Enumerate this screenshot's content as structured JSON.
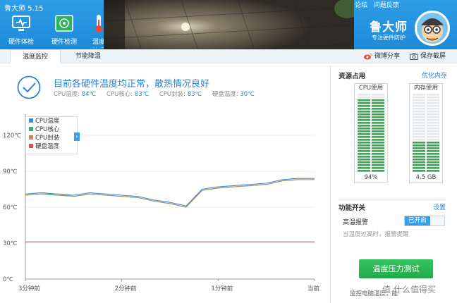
{
  "app": {
    "title": "鲁大师 5.15"
  },
  "nav": [
    {
      "label": "硬件体检",
      "icon": "monitor-health-icon"
    },
    {
      "label": "硬件检测",
      "icon": "circuit-board-icon"
    },
    {
      "label": "温度管理",
      "icon": "thermometer-icon"
    }
  ],
  "header_links": [
    "论坛",
    "问题反馈"
  ],
  "brand": {
    "name": "鲁大师",
    "subtitle": "专注硬件防护"
  },
  "tabs": [
    {
      "label": "温度监控",
      "active": true
    },
    {
      "label": "节能降温",
      "active": false
    }
  ],
  "share": {
    "weibo": "微博分享",
    "save": "保存截屏"
  },
  "status": {
    "message": "目前各硬件温度均正常，散热情况良好",
    "readings": [
      {
        "label": "CPU温度:",
        "value": "84℃"
      },
      {
        "label": "CPU核心:",
        "value": "83℃"
      },
      {
        "label": "CPU封装:",
        "value": "83℃"
      },
      {
        "label": "硬盘温度:",
        "value": "30℃"
      }
    ]
  },
  "legend_items": [
    {
      "label": "CPU温度",
      "color": "#3a8fe0"
    },
    {
      "label": "CPU核心",
      "color": "#3cb06a"
    },
    {
      "label": "CPU封装",
      "color": "#c08a5a"
    },
    {
      "label": "硬盘温度",
      "color": "#e05050"
    }
  ],
  "chart_data": {
    "type": "line",
    "y_ticks": [
      "120℃",
      "90℃",
      "60℃",
      "30℃",
      "0℃"
    ],
    "x_ticks": [
      "3分钟前",
      "2分钟前",
      "1分钟前",
      "当前"
    ],
    "ylim": [
      0,
      120
    ],
    "x": [
      -180,
      -170,
      -160,
      -150,
      -140,
      -130,
      -120,
      -110,
      -100,
      -90,
      -80,
      -70,
      -60,
      -50,
      -40,
      -30,
      -20,
      -10,
      0
    ],
    "series": [
      {
        "name": "CPU温度",
        "color": "#3a8fe0",
        "values": [
          71,
          72,
          71,
          70,
          72,
          71,
          70,
          69,
          66,
          64,
          61,
          75,
          77,
          78,
          79,
          80,
          83,
          84,
          84
        ]
      },
      {
        "name": "CPU核心",
        "color": "#3cb06a",
        "values": [
          70,
          71,
          70,
          69,
          71,
          70,
          69,
          68,
          65,
          63,
          60,
          74,
          76,
          77,
          78,
          79,
          82,
          83,
          83
        ]
      },
      {
        "name": "CPU封装",
        "color": "#c08a5a",
        "values": [
          70,
          71,
          71,
          69,
          71,
          70,
          69,
          68,
          65,
          63,
          60,
          74,
          76,
          77,
          78,
          79,
          82,
          83,
          83
        ]
      },
      {
        "name": "硬盘温度",
        "color": "#e05050",
        "values": [
          31,
          31,
          31,
          31,
          31,
          31,
          31,
          31,
          31,
          31,
          31,
          31,
          31,
          31,
          31,
          31,
          31,
          31,
          31
        ]
      }
    ]
  },
  "resources": {
    "title": "资源占用",
    "optimize": "优化内存",
    "cpu": {
      "label": "CPU使用",
      "value": "94%",
      "fraction": 0.94
    },
    "memory": {
      "label": "内存使用",
      "value": "4.5 GB",
      "fraction": 0.38
    }
  },
  "functions": {
    "title": "功能开关",
    "settings": "设置",
    "alarm_label": "高温报警",
    "alarm_state": "已开启",
    "alarm_desc": "当温度过高时，报警提醒"
  },
  "stress_button": "温度压力测试",
  "bottom": {
    "text": "监控电脑温度，能",
    "watermark": "值 什么值得买"
  }
}
